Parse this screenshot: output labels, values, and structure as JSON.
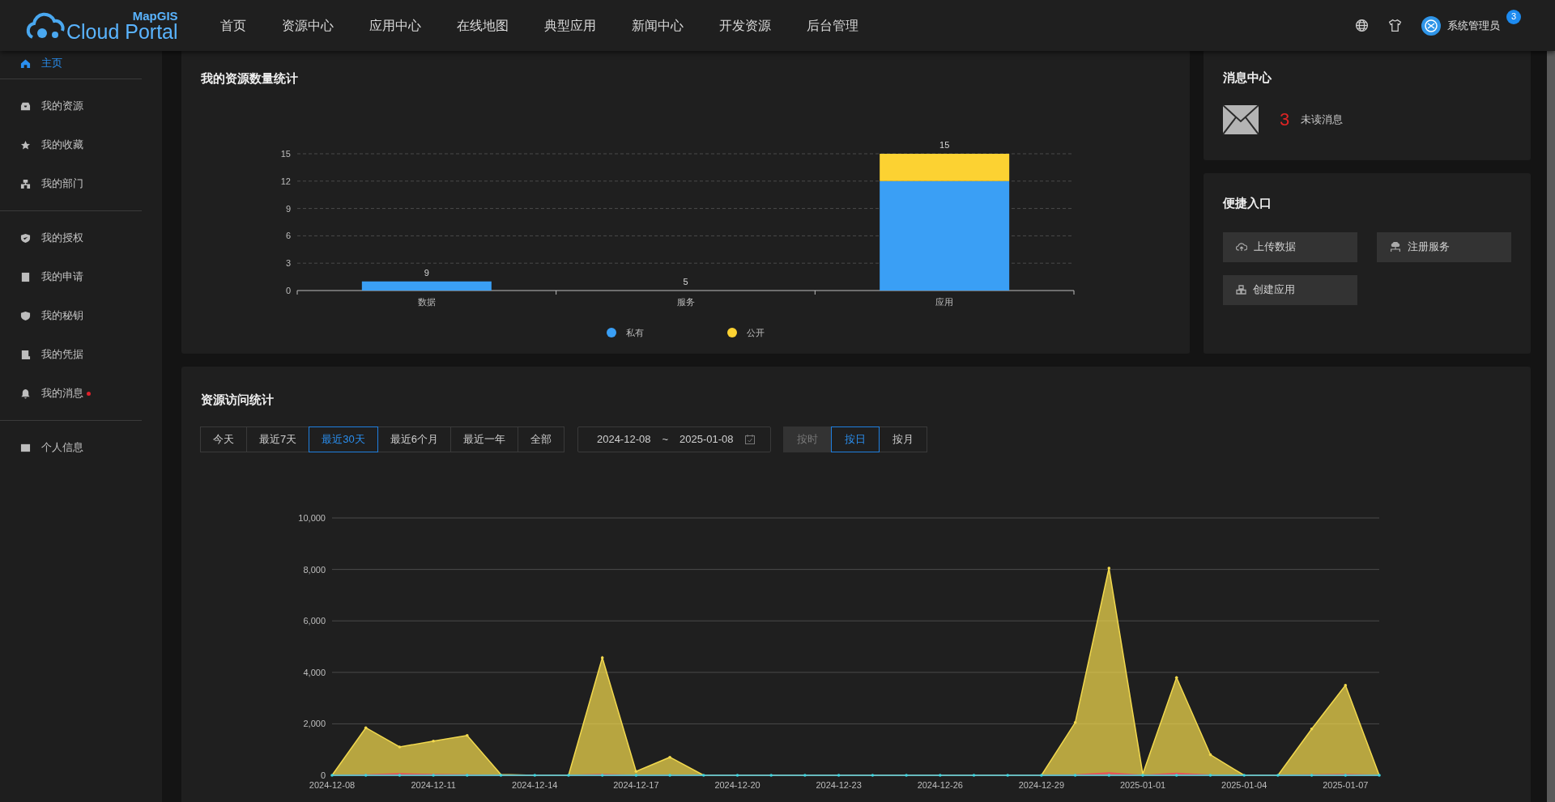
{
  "header": {
    "logo": {
      "top": "MapGIS",
      "main": "Cloud Portal"
    },
    "nav": [
      "首页",
      "资源中心",
      "应用中心",
      "在线地图",
      "典型应用",
      "新闻中心",
      "开发资源",
      "后台管理"
    ],
    "user": {
      "name": "系统管理员",
      "badge": "3"
    }
  },
  "sidebar": {
    "groups": [
      {
        "items": [
          {
            "label": "主页",
            "selected": true,
            "unread": false
          }
        ]
      },
      {
        "items": [
          {
            "label": "我的资源",
            "selected": false,
            "unread": false
          },
          {
            "label": "我的收藏",
            "selected": false,
            "unread": false
          },
          {
            "label": "我的部门",
            "selected": false,
            "unread": false
          }
        ]
      },
      {
        "items": [
          {
            "label": "我的授权",
            "selected": false,
            "unread": false
          },
          {
            "label": "我的申请",
            "selected": false,
            "unread": false
          },
          {
            "label": "我的秘钥",
            "selected": false,
            "unread": false
          },
          {
            "label": "我的凭据",
            "selected": false,
            "unread": false
          },
          {
            "label": "我的消息",
            "selected": false,
            "unread": true
          }
        ]
      },
      {
        "items": [
          {
            "label": "个人信息",
            "selected": false,
            "unread": false
          }
        ]
      }
    ]
  },
  "resource_stats": {
    "title": "我的资源数量统计",
    "chart_data": {
      "type": "bar",
      "stacked": true,
      "categories": [
        "数据",
        "服务",
        "应用"
      ],
      "series": [
        {
          "name": "私有",
          "color": "#3a9ff5",
          "values": [
            1,
            0,
            12
          ]
        },
        {
          "name": "公开",
          "color": "#fcd232",
          "values": [
            0,
            0,
            3
          ]
        }
      ],
      "ylim": [
        0,
        15
      ],
      "yticks": [
        0,
        3,
        6,
        9,
        12,
        15
      ],
      "value_labels": [
        "9",
        "5",
        "15"
      ],
      "grid": true,
      "legend": true
    }
  },
  "messages": {
    "title": "消息中心",
    "count": "3",
    "label": "未读消息"
  },
  "shortcuts": {
    "title": "便捷入口",
    "buttons": [
      "上传数据",
      "注册服务",
      "创建应用"
    ]
  },
  "access_stats": {
    "title": "资源访问统计",
    "ranges": [
      {
        "label": "今天",
        "selected": false
      },
      {
        "label": "最近7天",
        "selected": false
      },
      {
        "label": "最近30天",
        "selected": true
      },
      {
        "label": "最近6个月",
        "selected": false
      },
      {
        "label": "最近一年",
        "selected": false
      },
      {
        "label": "全部",
        "selected": false
      }
    ],
    "date_range": {
      "start": "2024-12-08",
      "separator": "~",
      "end": "2025-01-08"
    },
    "granularity": [
      {
        "label": "按时",
        "selected": false,
        "disabled": true
      },
      {
        "label": "按日",
        "selected": true,
        "disabled": false
      },
      {
        "label": "按月",
        "selected": false,
        "disabled": false
      }
    ],
    "chart_data": {
      "type": "area",
      "grid": true,
      "categories": [
        "2024-12-08",
        null,
        null,
        "2024-12-11",
        null,
        null,
        "2024-12-14",
        null,
        null,
        "2024-12-17",
        null,
        null,
        "2024-12-20",
        null,
        null,
        "2024-12-23",
        null,
        null,
        "2024-12-26",
        null,
        null,
        "2024-12-29",
        null,
        null,
        "2025-01-01",
        null,
        null,
        "2025-01-04",
        null,
        null,
        "2025-01-07",
        null
      ],
      "ylim": [
        0,
        10000
      ],
      "yticks": [
        {
          "value": 0,
          "label": "0"
        },
        {
          "value": 2000,
          "label": "2,000"
        },
        {
          "value": 4000,
          "label": "4,000"
        },
        {
          "value": 6000,
          "label": "6,000"
        },
        {
          "value": 8000,
          "label": "8,000"
        },
        {
          "value": 10000,
          "label": "10,000"
        }
      ],
      "series": [
        {
          "color": "#f2d94e",
          "values": [
            0,
            1850,
            1100,
            1330,
            1550,
            30,
            0,
            0,
            4570,
            150,
            700,
            0,
            0,
            0,
            0,
            0,
            0,
            0,
            0,
            0,
            0,
            0,
            2050,
            8050,
            50,
            3800,
            800,
            0,
            0,
            1800,
            3500,
            0
          ]
        },
        {
          "color": "#e8505b",
          "values": [
            0,
            20,
            60,
            30,
            20,
            0,
            0,
            0,
            30,
            0,
            10,
            0,
            0,
            0,
            0,
            0,
            0,
            0,
            0,
            0,
            0,
            0,
            20,
            90,
            0,
            80,
            10,
            0,
            0,
            20,
            30,
            0
          ]
        }
      ]
    }
  }
}
